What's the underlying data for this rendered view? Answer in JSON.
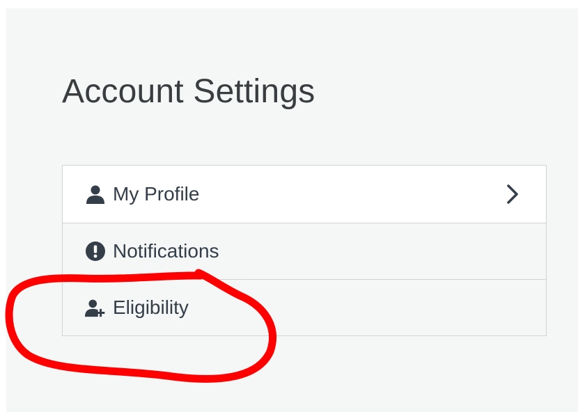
{
  "page": {
    "title": "Account Settings"
  },
  "menu": {
    "items": [
      {
        "label": "My Profile",
        "icon": "user-icon",
        "has_chevron": true
      },
      {
        "label": "Notifications",
        "icon": "exclamation-circle-icon",
        "has_chevron": false
      },
      {
        "label": "Eligibility",
        "icon": "user-plus-icon",
        "has_chevron": false
      }
    ]
  },
  "colors": {
    "background": "#f5f6f6",
    "text": "#333e48",
    "border": "#d0d3d4",
    "annotation": "#ff0000"
  }
}
